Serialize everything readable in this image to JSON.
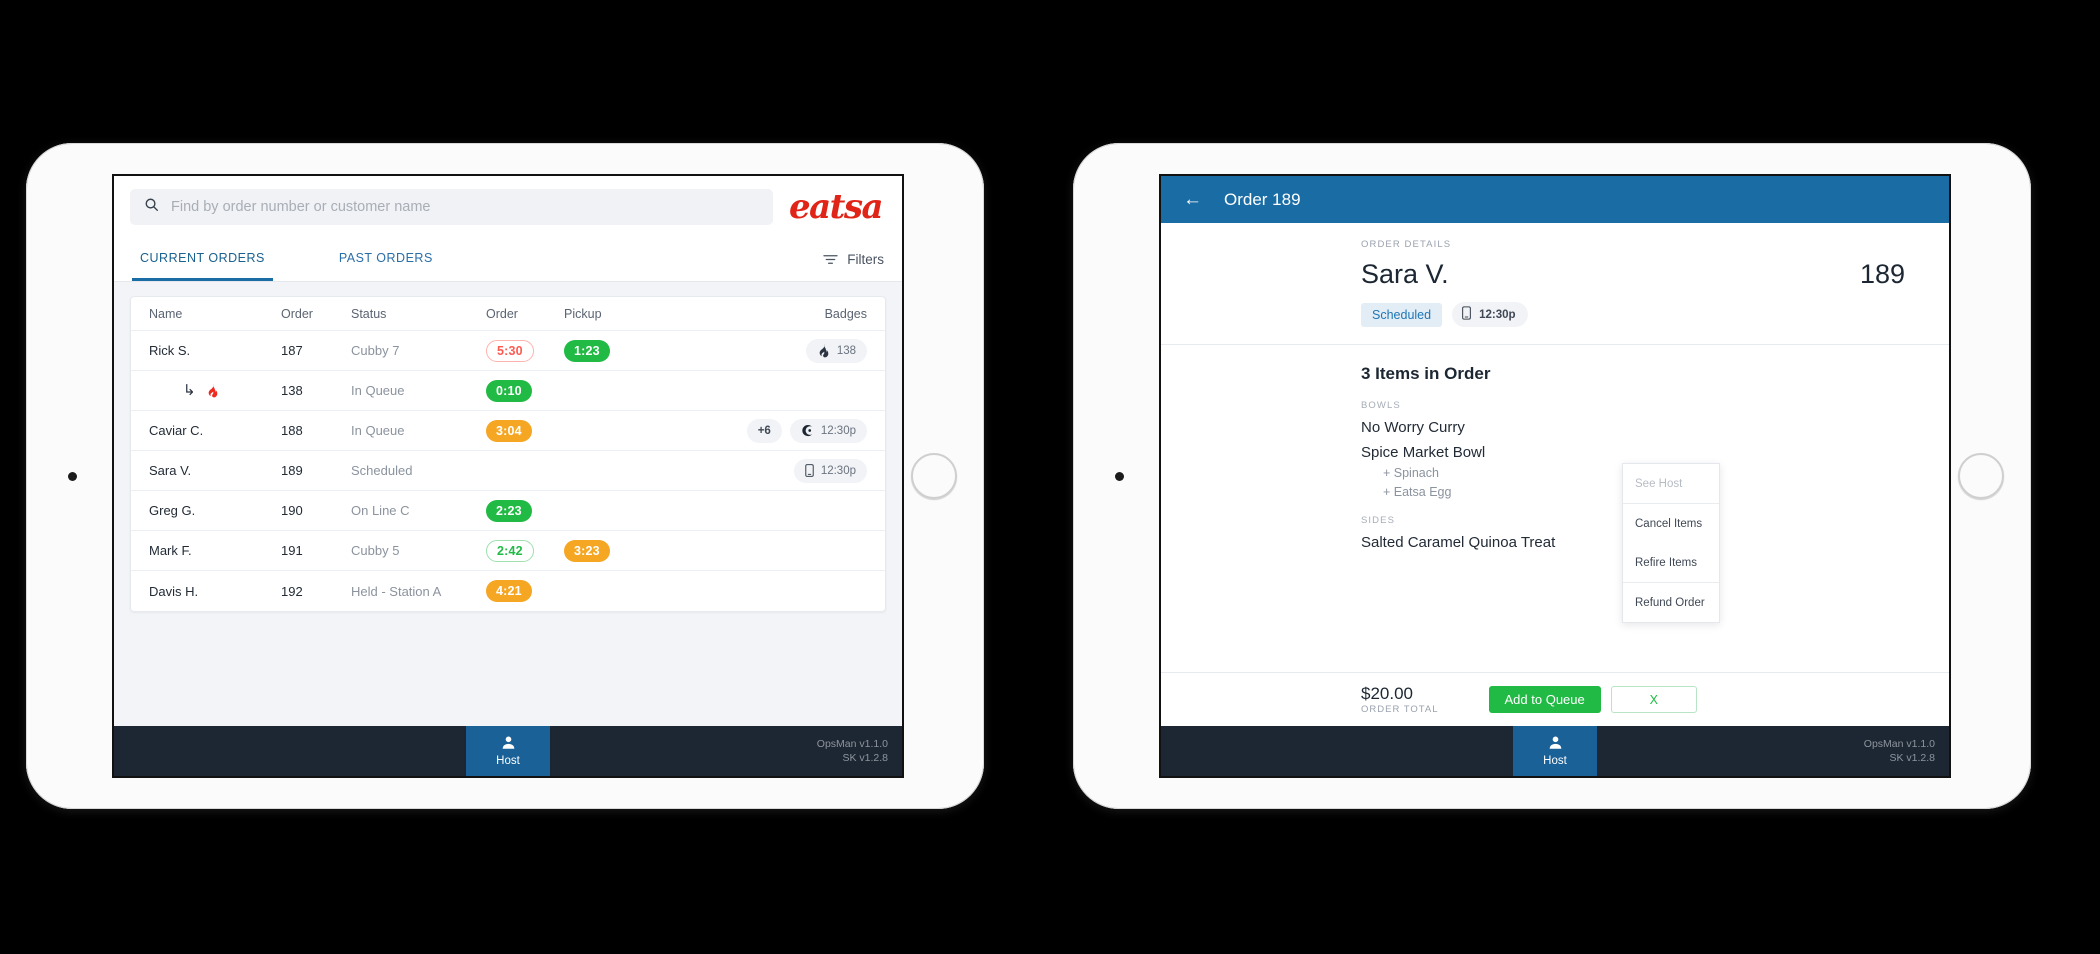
{
  "left_device": {
    "search": {
      "placeholder": "Find by order number or customer name",
      "value": "",
      "icon": "search-icon"
    },
    "logo": "eatsa",
    "tabs": [
      {
        "label": "CURRENT ORDERS",
        "active": true
      },
      {
        "label": "PAST ORDERS",
        "active": false
      }
    ],
    "filters_label": "Filters",
    "table": {
      "columns": [
        "Name",
        "Order",
        "Status",
        "Order",
        "Pickup",
        "Badges"
      ],
      "rows": [
        {
          "name": "Rick S.",
          "order": "187",
          "status": "Cubby 7",
          "order_timer": {
            "text": "5:30",
            "style": "red-out"
          },
          "pickup_timer": {
            "text": "1:23",
            "style": "green-solid"
          },
          "badges": [
            {
              "icon": "flame-icon",
              "text": "138"
            }
          ],
          "is_sub": false
        },
        {
          "name": "",
          "order": "138",
          "status": "In Queue",
          "order_timer": {
            "text": "0:10",
            "style": "green-solid"
          },
          "pickup_timer": null,
          "badges": [],
          "is_sub": true,
          "sub_icons": [
            "sub-arrow-icon",
            "flame-red-icon"
          ]
        },
        {
          "name": "Caviar C.",
          "order": "188",
          "status": "In Queue",
          "order_timer": {
            "text": "3:04",
            "style": "orange-solid"
          },
          "pickup_timer": null,
          "badges": [
            {
              "icon": null,
              "text": "+6"
            },
            {
              "icon": "caviar-icon",
              "text": "12:30p"
            }
          ],
          "is_sub": false
        },
        {
          "name": "Sara V.",
          "order": "189",
          "status": "Scheduled",
          "order_timer": null,
          "pickup_timer": null,
          "badges": [
            {
              "icon": "phone-icon",
              "text": "12:30p"
            }
          ],
          "is_sub": false
        },
        {
          "name": "Greg G.",
          "order": "190",
          "status": "On Line C",
          "order_timer": {
            "text": "2:23",
            "style": "green-solid"
          },
          "pickup_timer": null,
          "badges": [],
          "is_sub": false
        },
        {
          "name": "Mark F.",
          "order": "191",
          "status": "Cubby 5",
          "order_timer": {
            "text": "2:42",
            "style": "green-out"
          },
          "pickup_timer": {
            "text": "3:23",
            "style": "orange-solid"
          },
          "badges": [],
          "is_sub": false
        },
        {
          "name": "Davis H.",
          "order": "192",
          "status": "Held - Station A",
          "order_timer": {
            "text": "4:21",
            "style": "orange-solid"
          },
          "pickup_timer": null,
          "badges": [],
          "is_sub": false
        }
      ]
    },
    "bottom_bar": {
      "host_label": "Host",
      "version_app": "OpsMan v1.1.0",
      "version_sk": "SK v1.2.8"
    }
  },
  "right_device": {
    "header": {
      "back_icon": "back-arrow-icon",
      "title": "Order 189"
    },
    "order_details": {
      "section_label": "ORDER DETAILS",
      "customer_name": "Sara V.",
      "order_number": "189",
      "status_chip": "Scheduled",
      "pickup_time": "12:30p"
    },
    "items": {
      "heading": "3 Items in Order",
      "groups": [
        {
          "label": "BOWLS",
          "entries": [
            {
              "name": "No Worry Curry",
              "mods": []
            },
            {
              "name": "Spice Market Bowl",
              "mods": [
                "+ Spinach",
                "+ Eatsa Egg"
              ]
            }
          ]
        },
        {
          "label": "SIDES",
          "entries": [
            {
              "name": "Salted Caramel Quinoa Treat",
              "mods": []
            }
          ]
        }
      ]
    },
    "context_menu": [
      {
        "label": "See Host",
        "disabled": true
      },
      {
        "label": "Cancel Items",
        "disabled": false
      },
      {
        "label": "Refire Items",
        "disabled": false
      },
      {
        "label": "Refund Order",
        "disabled": false
      }
    ],
    "footer": {
      "total_amount": "$20.00",
      "total_label": "ORDER TOTAL",
      "primary_button": "Add to Queue",
      "secondary_button": "X"
    },
    "bottom_bar": {
      "host_label": "Host",
      "version_app": "OpsMan v1.1.0",
      "version_sk": "SK v1.2.8"
    }
  },
  "colors": {
    "brand_red": "#e02518",
    "header_blue": "#1a6ca5",
    "green": "#21ba45",
    "orange": "#f5a623",
    "red": "#ff5a52",
    "dark_bar": "#1d2733"
  }
}
